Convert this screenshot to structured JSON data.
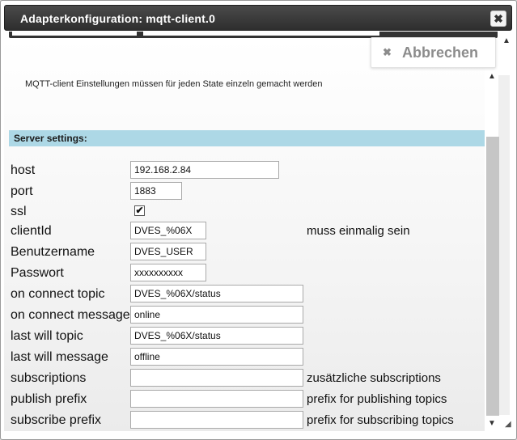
{
  "dialog": {
    "title": "Adapterkonfiguration: mqtt-client.0",
    "close_icon": "✖",
    "cancel_icon": "✖",
    "cancel_label": "Abbrechen"
  },
  "info_text": "MQTT-client Einstellungen müssen für jeden State einzeln gemacht werden",
  "section": {
    "title": "Server settings:"
  },
  "fields": {
    "host": {
      "label": "host",
      "value": "192.168.2.84"
    },
    "port": {
      "label": "port",
      "value": "1883"
    },
    "ssl": {
      "label": "ssl",
      "checked": true,
      "mark": "✔"
    },
    "clientId": {
      "label": "clientId",
      "value": "DVES_%06X",
      "hint": "muss einmalig sein"
    },
    "username": {
      "label": "Benutzername",
      "value": "DVES_USER"
    },
    "password": {
      "label": "Passwort",
      "value": "xxxxxxxxxx"
    },
    "on_connect_topic": {
      "label": "on connect topic",
      "value": "DVES_%06X/status"
    },
    "on_connect_message": {
      "label": "on connect message",
      "value": "online"
    },
    "last_will_topic": {
      "label": "last will topic",
      "value": "DVES_%06X/status"
    },
    "last_will_message": {
      "label": "last will message",
      "value": "offline"
    },
    "subscriptions": {
      "label": "subscriptions",
      "value": "",
      "hint": "zusätzliche subscriptions"
    },
    "publish_prefix": {
      "label": "publish prefix",
      "value": "",
      "hint": "prefix for publishing topics"
    },
    "subscribe_prefix": {
      "label": "subscribe prefix",
      "value": "",
      "hint": "prefix for subscribing topics"
    }
  },
  "scroll": {
    "up_icon": "▲",
    "down_icon": "▼",
    "resize_icon": "◢"
  },
  "colors": {
    "titlebar": "#333333",
    "section_header": "#add8e6"
  }
}
